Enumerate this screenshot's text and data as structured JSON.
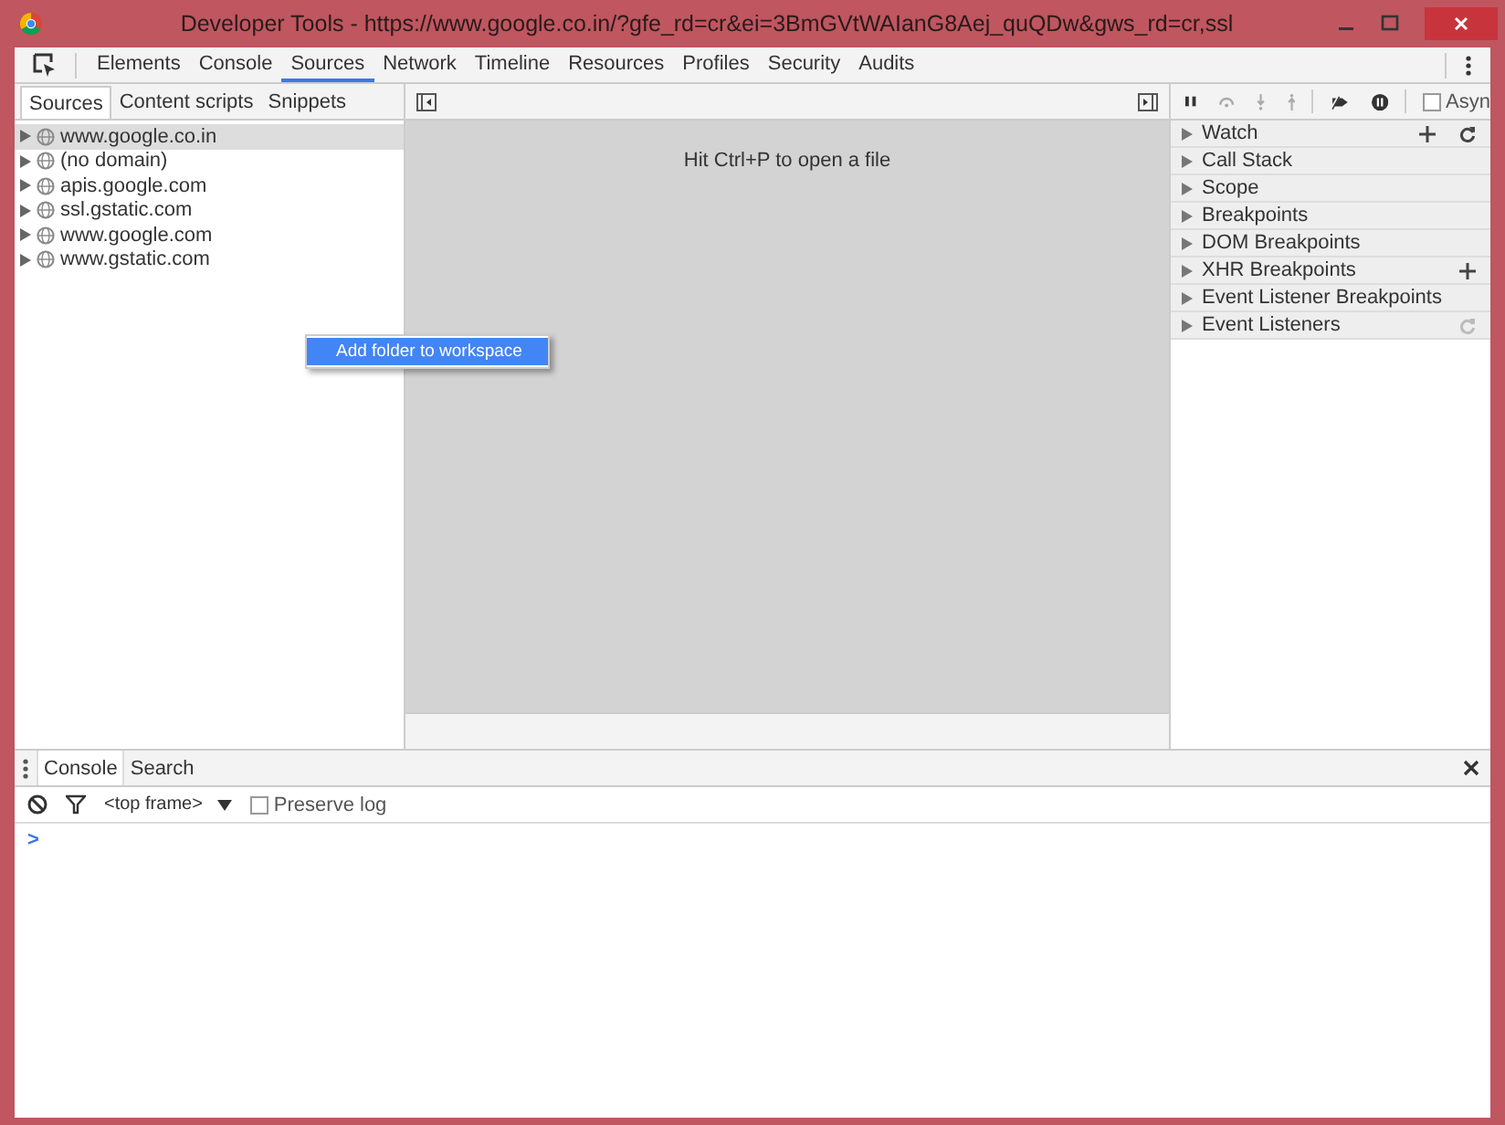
{
  "window": {
    "title": "Developer Tools - https://www.google.co.in/?gfe_rd=cr&ei=3BmGVtWAIanG8Aej_quQDw&gws_rd=cr,ssl"
  },
  "toolbar": {
    "tabs": [
      {
        "label": "Elements",
        "selected": false
      },
      {
        "label": "Console",
        "selected": false
      },
      {
        "label": "Sources",
        "selected": true
      },
      {
        "label": "Network",
        "selected": false
      },
      {
        "label": "Timeline",
        "selected": false
      },
      {
        "label": "Resources",
        "selected": false
      },
      {
        "label": "Profiles",
        "selected": false
      },
      {
        "label": "Security",
        "selected": false
      },
      {
        "label": "Audits",
        "selected": false
      }
    ]
  },
  "navigator": {
    "tabs": [
      {
        "label": "Sources",
        "selected": true
      },
      {
        "label": "Content scripts",
        "selected": false
      },
      {
        "label": "Snippets",
        "selected": false
      }
    ],
    "tree": [
      {
        "label": "www.google.co.in",
        "selected": true
      },
      {
        "label": "(no domain)",
        "selected": false
      },
      {
        "label": "apis.google.com",
        "selected": false
      },
      {
        "label": "ssl.gstatic.com",
        "selected": false
      },
      {
        "label": "www.google.com",
        "selected": false
      },
      {
        "label": "www.gstatic.com",
        "selected": false
      }
    ]
  },
  "context_menu": {
    "items": [
      {
        "label": "Add folder to workspace",
        "selected": true
      }
    ]
  },
  "editor": {
    "hint": "Hit Ctrl+P to open a file"
  },
  "debugger": {
    "async": {
      "label": "Asyn",
      "checked": false
    },
    "sections": [
      {
        "label": "Watch",
        "actions": [
          {
            "kind": "add",
            "disabled": false
          },
          {
            "kind": "refresh",
            "disabled": false
          }
        ]
      },
      {
        "label": "Call Stack"
      },
      {
        "label": "Scope"
      },
      {
        "label": "Breakpoints"
      },
      {
        "label": "DOM Breakpoints"
      },
      {
        "label": "XHR Breakpoints",
        "actions": [
          {
            "kind": "add",
            "disabled": false
          }
        ]
      },
      {
        "label": "Event Listener Breakpoints"
      },
      {
        "label": "Event Listeners",
        "actions": [
          {
            "kind": "refresh",
            "disabled": true
          }
        ]
      }
    ]
  },
  "drawer": {
    "tabs": [
      {
        "label": "Console",
        "selected": true
      },
      {
        "label": "Search",
        "selected": false
      }
    ],
    "context": "<top frame>",
    "preserve_log": {
      "label": "Preserve log",
      "checked": false
    },
    "prompt": ">"
  }
}
